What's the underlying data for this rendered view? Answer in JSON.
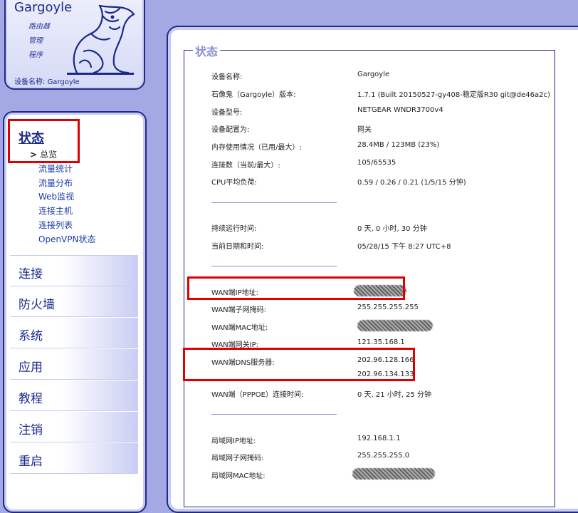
{
  "header": {
    "title": "Gargoyle",
    "sub": [
      "路由器",
      "管理",
      "程序"
    ],
    "device_name_label": "设备名称:",
    "device_name": "Gargoyle"
  },
  "nav": {
    "status_title": "状态",
    "current": "总览",
    "current_marker": ">",
    "sub_items": [
      "流量统计",
      "流量分布",
      "Web监视",
      "连接主机",
      "连接列表",
      "OpenVPN状态"
    ],
    "sections": [
      "连接",
      "防火墙",
      "系统",
      "应用",
      "教程",
      "注销",
      "重启"
    ]
  },
  "main": {
    "legend": "状态",
    "group1": [
      {
        "label": "设备名称:",
        "value": "Gargoyle"
      },
      {
        "label": "石像鬼（Gargoyle）版本:",
        "value": "1.7.1 (Built 20150527-gy408-稳定版R30 git@de46a2c)"
      },
      {
        "label": "设备型号:",
        "value": "NETGEAR WNDR3700v4"
      },
      {
        "label": "设备配置为:",
        "value": "网关"
      },
      {
        "label": "内存使用情况（已用/最大）:",
        "value": "28.4MB / 123MB (23%)"
      },
      {
        "label": "连接数（当前/最大）:",
        "value": "105/65535"
      },
      {
        "label": "CPU平均负荷:",
        "value": "0.59 / 0.26 / 0.21  (1/5/15 分钟)"
      }
    ],
    "group2": [
      {
        "label": "持续运行时间:",
        "value": "0 天, 0 小时, 30 分钟"
      },
      {
        "label": "当前日期和时间:",
        "value": "05/28/15 下午 8:27 UTC+8"
      }
    ],
    "group3": [
      {
        "label": "WAN端IP地址:",
        "value": ""
      },
      {
        "label": "WAN端子网掩码:",
        "value": "255.255.255.255"
      },
      {
        "label": "WAN端MAC地址:",
        "value": ""
      },
      {
        "label": "WAN端网关IP:",
        "value": "121.35.168.1"
      },
      {
        "label": "WAN端DNS服务器:",
        "value": "202.96.128.166"
      },
      {
        "label": "",
        "value": "202.96.134.133"
      },
      {
        "label": "WAN端（PPPOE）连接时间:",
        "value": "0 天, 21 小时, 25 分钟"
      }
    ],
    "group4": [
      {
        "label": "局域网IP地址:",
        "value": "192.168.1.1"
      },
      {
        "label": "局域网子网掩码:",
        "value": "255.255.255.0"
      },
      {
        "label": "局域网MAC地址:",
        "value": ""
      }
    ]
  }
}
